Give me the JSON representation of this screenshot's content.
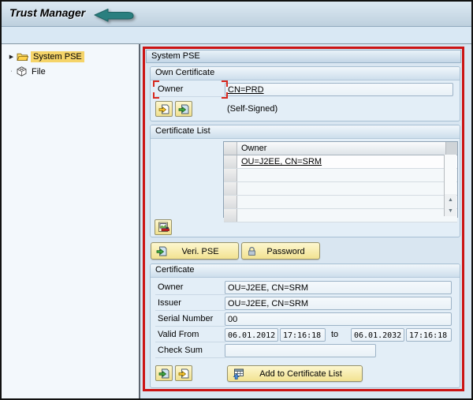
{
  "window": {
    "title": "Trust Manager"
  },
  "colors": {
    "annotation_red": "#cc1414",
    "annotation_teal": "#2a7f7f",
    "tree_selection": "#f5d469",
    "button_yellow": "#f7ecab",
    "panel_blue": "#d9e6f1"
  },
  "icons": {
    "tree_expander": "▶",
    "tree_bullet": "·",
    "scroll_up": "▲",
    "scroll_down": "▼"
  },
  "sidebar": {
    "items": [
      {
        "label": "System PSE",
        "icon": "folder-icon",
        "selected": true
      },
      {
        "label": "File",
        "icon": "pse-box-icon",
        "selected": false
      }
    ]
  },
  "main": {
    "panel_title": "System PSE",
    "own_certificate": {
      "title": "Own Certificate",
      "owner_label": "Owner",
      "owner_value": "CN=PRD",
      "self_signed_note": "(Self-Signed)"
    },
    "certificate_list": {
      "title": "Certificate List",
      "table": {
        "columns": [
          "Owner"
        ],
        "rows": [
          "OU=J2EE, CN=SRM",
          "",
          "",
          "",
          ""
        ]
      }
    },
    "actions": {
      "veri_pse_label": "Veri. PSE",
      "password_label": "Password"
    },
    "certificate": {
      "title": "Certificate",
      "rows": [
        {
          "label": "Owner",
          "value": "OU=J2EE, CN=SRM"
        },
        {
          "label": "Issuer",
          "value": "OU=J2EE, CN=SRM"
        },
        {
          "label": "Serial Number",
          "value": "00"
        }
      ],
      "valid": {
        "label": "Valid From",
        "from_date": "06.01.2012",
        "from_time": "17:16:18",
        "to_word": "to",
        "to_date": "06.01.2032",
        "to_time": "17:16:18"
      },
      "checksum": {
        "label": "Check Sum",
        "value": ""
      },
      "add_button_label": "Add to Certificate List"
    }
  }
}
